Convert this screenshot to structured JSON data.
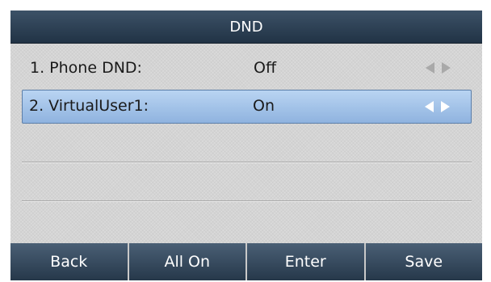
{
  "screen": {
    "title": "DND",
    "items": [
      {
        "label": "1. Phone DND:",
        "value": "Off",
        "selected": false
      },
      {
        "label": "2. VirtualUser1:",
        "value": "On",
        "selected": true
      }
    ],
    "icons": {
      "prev": "left-arrow-icon",
      "next": "right-arrow-icon"
    },
    "colors": {
      "title_bar": "#2e4256",
      "selection": "#a7c6ec",
      "softkey": "#3a4e63"
    }
  },
  "softkeys": [
    "Back",
    "All On",
    "Enter",
    "Save"
  ]
}
